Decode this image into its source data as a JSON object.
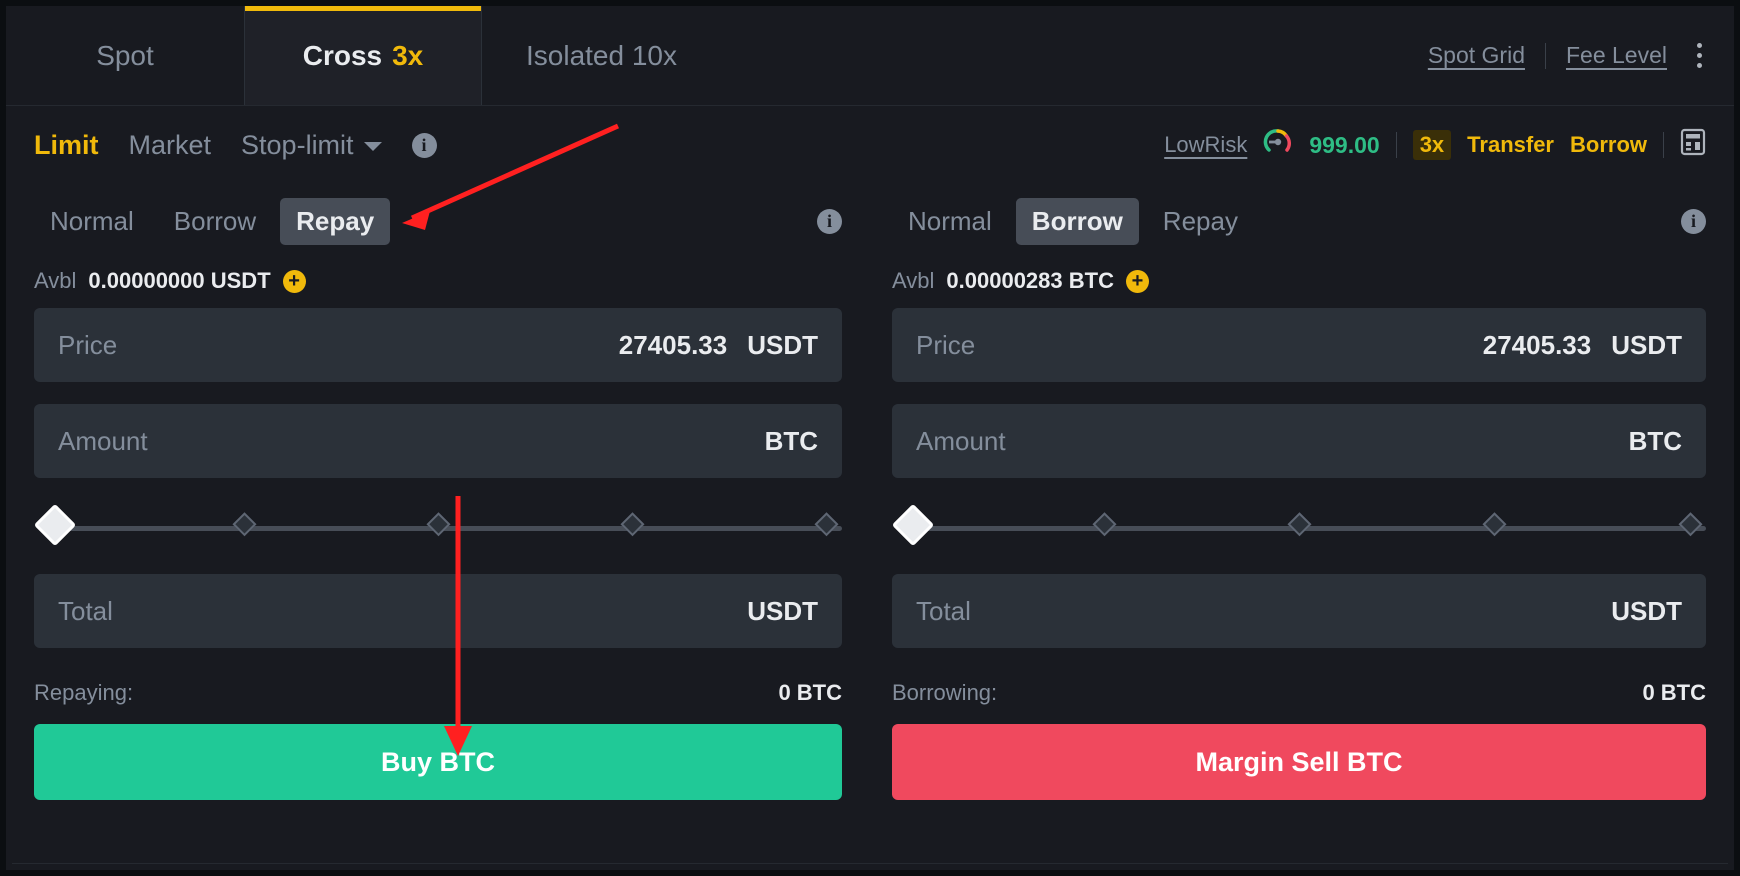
{
  "header": {
    "tabs": [
      {
        "label": "Spot",
        "leverage": "",
        "active": false
      },
      {
        "label": "Cross",
        "leverage": "3x",
        "active": true
      },
      {
        "label": "Isolated 10x",
        "leverage": "",
        "active": false
      }
    ],
    "links": [
      {
        "label": "Spot Grid"
      },
      {
        "label": "Fee Level"
      }
    ],
    "menu_icon": "kebab-menu-icon"
  },
  "order_type": {
    "items": [
      {
        "label": "Limit",
        "active": true
      },
      {
        "label": "Market",
        "active": false
      },
      {
        "label": "Stop-limit",
        "active": false
      }
    ],
    "dropdown_icon": "chevron-down-icon",
    "info_icon": "info-icon",
    "info_glyph": "i",
    "risk_label": "LowRisk",
    "risk_gauge_icon": "risk-gauge-icon",
    "risk_value": "999.00",
    "leverage_badge": "3x",
    "transfer_label": "Transfer",
    "borrow_label": "Borrow",
    "calculator_icon": "calculator-icon"
  },
  "buy_panel": {
    "modes": [
      {
        "label": "Normal",
        "active": false
      },
      {
        "label": "Borrow",
        "active": false
      },
      {
        "label": "Repay",
        "active": true
      }
    ],
    "info_icon": "info-icon",
    "avbl_label": "Avbl",
    "avbl_value": "0.00000000 USDT",
    "add_funds_icon": "plus-circle-icon",
    "price": {
      "label": "Price",
      "value": "27405.33",
      "unit": "USDT"
    },
    "amount": {
      "label": "Amount",
      "value": "",
      "unit": "BTC"
    },
    "total": {
      "label": "Total",
      "value": "",
      "unit": "USDT"
    },
    "slider": {
      "percent": 0,
      "ticks": [
        0,
        25,
        50,
        75,
        100
      ]
    },
    "summary_label": "Repaying:",
    "summary_value": "0 BTC",
    "action_label": "Buy BTC"
  },
  "sell_panel": {
    "modes": [
      {
        "label": "Normal",
        "active": false
      },
      {
        "label": "Borrow",
        "active": true
      },
      {
        "label": "Repay",
        "active": false
      }
    ],
    "info_icon": "info-icon",
    "avbl_label": "Avbl",
    "avbl_value": "0.00000283 BTC",
    "add_funds_icon": "plus-circle-icon",
    "price": {
      "label": "Price",
      "value": "27405.33",
      "unit": "USDT"
    },
    "amount": {
      "label": "Amount",
      "value": "",
      "unit": "BTC"
    },
    "total": {
      "label": "Total",
      "value": "",
      "unit": "USDT"
    },
    "slider": {
      "percent": 0,
      "ticks": [
        0,
        25,
        50,
        75,
        100
      ]
    },
    "summary_label": "Borrowing:",
    "summary_value": "0 BTC",
    "action_label": "Margin Sell BTC"
  },
  "annotations": {
    "arrow_to_repay": "red-arrow-pointing-to-repay-tab",
    "arrow_to_buy": "red-arrow-pointing-to-buy-button",
    "color": "#ff2020"
  },
  "colors": {
    "accent": "#f0b90b",
    "buy": "#20c997",
    "sell": "#f0495e",
    "background": "#181a20",
    "field": "#2b3139",
    "muted": "#848e9c",
    "text": "#eaecef",
    "risk_green": "#2ebd85"
  }
}
